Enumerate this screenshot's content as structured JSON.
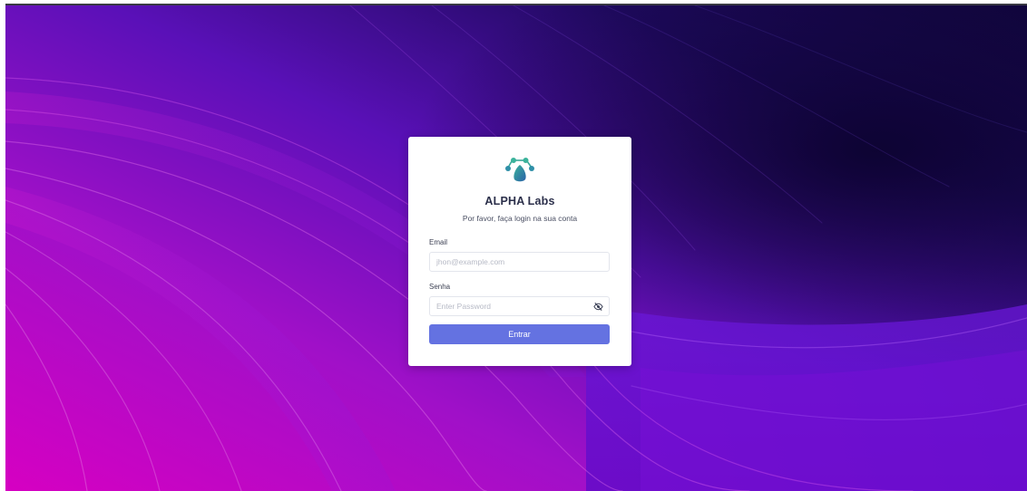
{
  "app": {
    "brand": "ALPHA Labs",
    "subtitle": "Por favor, faça login na sua conta",
    "logo_icon": "paw-icon"
  },
  "form": {
    "email_label": "Email",
    "email_placeholder": "jhon@example.com",
    "email_value": "",
    "password_label": "Senha",
    "password_placeholder": "Enter Password",
    "password_value": "",
    "password_toggle_icon": "eye-off-icon",
    "submit_label": "Entrar"
  },
  "colors": {
    "accent": "#6472e1",
    "background_dark": "#1a0648",
    "background_magenta": "#d400c0",
    "logo_primary": "#2a7fa8",
    "logo_secondary": "#3aa89a"
  }
}
